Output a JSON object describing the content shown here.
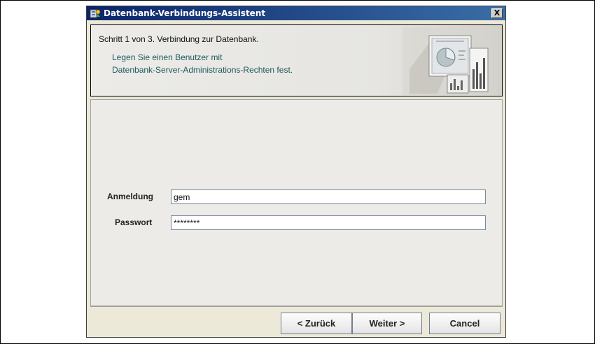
{
  "window": {
    "title": "Datenbank-Verbindungs-Assistent",
    "close_label": "X"
  },
  "header": {
    "step_text": "Schritt 1 von 3. Verbindung zur Datenbank.",
    "desc_line1": "Legen Sie einen Benutzer mit",
    "desc_line2": "Datenbank-Server-Administrations-Rechten fest."
  },
  "form": {
    "login_label": "Anmeldung",
    "login_value": "gem",
    "password_label": "Passwort",
    "password_value": "********"
  },
  "buttons": {
    "back_label": "< Zurück",
    "next_label": "Weiter >",
    "cancel_label": "Cancel"
  },
  "colors": {
    "titlebar_start": "#0a246a",
    "titlebar_end": "#3a6ea5",
    "desc_text": "#1e5a5a"
  }
}
